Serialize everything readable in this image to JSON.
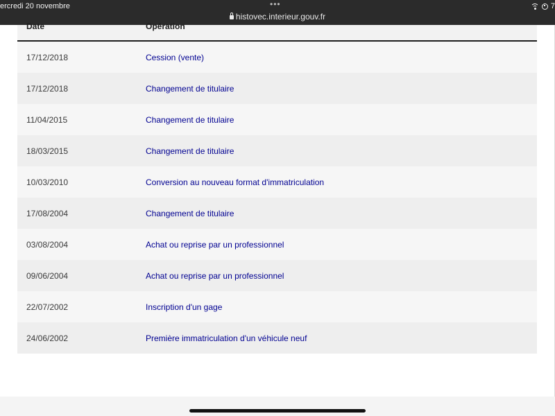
{
  "status_bar": {
    "time_date": "ercredi 20 novembre",
    "url": "histovec.interieur.gouv.fr",
    "battery_fragment": "7"
  },
  "table": {
    "headers": {
      "date": "Date",
      "operation": "Opération"
    },
    "rows": [
      {
        "date": "17/12/2018",
        "operation": "Cession (vente)"
      },
      {
        "date": "17/12/2018",
        "operation": "Changement de titulaire"
      },
      {
        "date": "11/04/2015",
        "operation": "Changement de titulaire"
      },
      {
        "date": "18/03/2015",
        "operation": "Changement de titulaire"
      },
      {
        "date": "10/03/2010",
        "operation": "Conversion au nouveau format d'immatriculation"
      },
      {
        "date": "17/08/2004",
        "operation": "Changement de titulaire"
      },
      {
        "date": "03/08/2004",
        "operation": "Achat ou reprise par un professionnel"
      },
      {
        "date": "09/06/2004",
        "operation": "Achat ou reprise par un professionnel"
      },
      {
        "date": "22/07/2002",
        "operation": "Inscription d'un gage"
      },
      {
        "date": "24/06/2002",
        "operation": "Première immatriculation d'un véhicule neuf"
      }
    ]
  },
  "colors": {
    "link": "#000091",
    "header_border": "#1e1e1e",
    "row_odd": "#f6f6f6",
    "row_even": "#eeeeee"
  }
}
